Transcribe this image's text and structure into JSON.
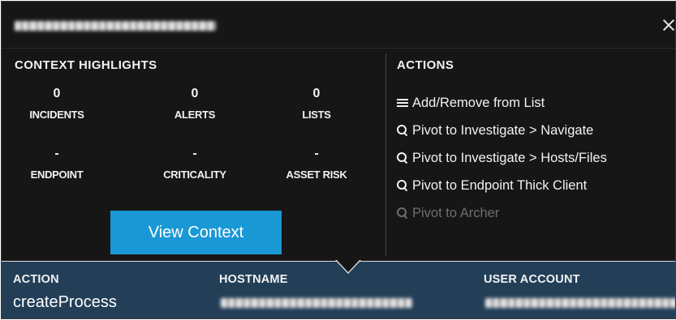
{
  "titlebar": {
    "title_redacted": true
  },
  "context": {
    "title": "CONTEXT HIGHLIGHTS",
    "row1": [
      {
        "value": "0",
        "label": "INCIDENTS"
      },
      {
        "value": "0",
        "label": "ALERTS"
      },
      {
        "value": "0",
        "label": "LISTS"
      }
    ],
    "row2": [
      {
        "value": "-",
        "label": "ENDPOINT"
      },
      {
        "value": "-",
        "label": "CRITICALITY"
      },
      {
        "value": "-",
        "label": "ASSET RISK"
      }
    ],
    "view_button": "View Context"
  },
  "actions": {
    "title": "ACTIONS",
    "items": [
      {
        "icon": "list-icon",
        "label": "Add/Remove from List",
        "enabled": true
      },
      {
        "icon": "search-icon",
        "label": "Pivot to Investigate > Navigate",
        "enabled": true
      },
      {
        "icon": "search-icon",
        "label": "Pivot to Investigate > Hosts/Files",
        "enabled": true
      },
      {
        "icon": "search-icon",
        "label": "Pivot to Endpoint Thick Client",
        "enabled": true
      },
      {
        "icon": "search-icon",
        "label": "Pivot to Archer",
        "enabled": false
      }
    ]
  },
  "event": {
    "columns": [
      {
        "label": "ACTION",
        "value": "createProcess"
      },
      {
        "label": "HOSTNAME",
        "value_redacted": true
      },
      {
        "label": "USER ACCOUNT",
        "value_redacted": true
      }
    ]
  },
  "colors": {
    "panel_bg": "#161616",
    "button_blue": "#1a98d6",
    "footer_bg": "#233f58",
    "disabled_text": "#6e6e6e"
  }
}
